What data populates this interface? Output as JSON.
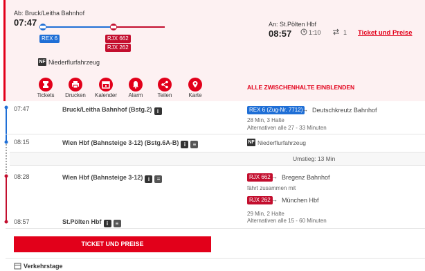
{
  "departure": {
    "label": "Ab: Bruck/Leitha Bahnhof",
    "time": "07:47"
  },
  "arrival": {
    "label": "An: St.Pölten Hbf",
    "time": "08:57",
    "duration": "1:10",
    "changes": "1"
  },
  "ticket_link": "Ticket und Preise",
  "trains": {
    "rex": "REX 6",
    "rjx1": "RJX 662",
    "rjx2": "RJX 262"
  },
  "low_floor": {
    "tag": "NF",
    "label": "Niederflurfahrzeug"
  },
  "actions": [
    {
      "label": "Tickets",
      "icon": "ticket-icon"
    },
    {
      "label": "Drucken",
      "icon": "print-icon"
    },
    {
      "label": "Kalender",
      "icon": "calendar-icon"
    },
    {
      "label": "Alarm",
      "icon": "bell-icon"
    },
    {
      "label": "Teilen",
      "icon": "share-icon"
    },
    {
      "label": "Karte",
      "icon": "map-icon"
    }
  ],
  "show_all_stops": "ALLE ZWISCHENHALTE EINBLENDEN",
  "legs": [
    {
      "dep_time": "07:47",
      "dep_stop": "Bruck/Leitha Bahnhof (Bstg.2)",
      "arr_time": "08:15",
      "arr_stop": "Wien Hbf (Bahnsteige 3-12) (Bstg.6A-B)",
      "train": "REX 6 (Zug-Nr. 7712)",
      "destination": "Deutschkreutz Bahnhof",
      "details1": "28 Min, 3 Halte",
      "details2": "Alternativen alle 27 - 33 Minuten",
      "vehicle": "Niederflurfahrzeug"
    },
    {
      "dep_time": "08:28",
      "dep_stop": "Wien Hbf (Bahnsteige 3-12)",
      "arr_time": "08:57",
      "arr_stop": "St.Pölten Hbf",
      "train": "RJX 662",
      "destination": "Bregenz Bahnhof",
      "joined_note": "fährt zusammen mit",
      "train2": "RJX 262",
      "destination2": "München Hbf",
      "details1": "29 Min, 2 Halte",
      "details2": "Alternativen alle 15 - 60 Minuten"
    }
  ],
  "transfer": "Umstieg: 13 Min",
  "cta": "TICKET UND PREISE",
  "operating_days": "Verkehrstage",
  "colors": {
    "accent": "#e2001a",
    "rex_blue": "#1f6fd6",
    "rjx_red": "#c30e2e"
  }
}
